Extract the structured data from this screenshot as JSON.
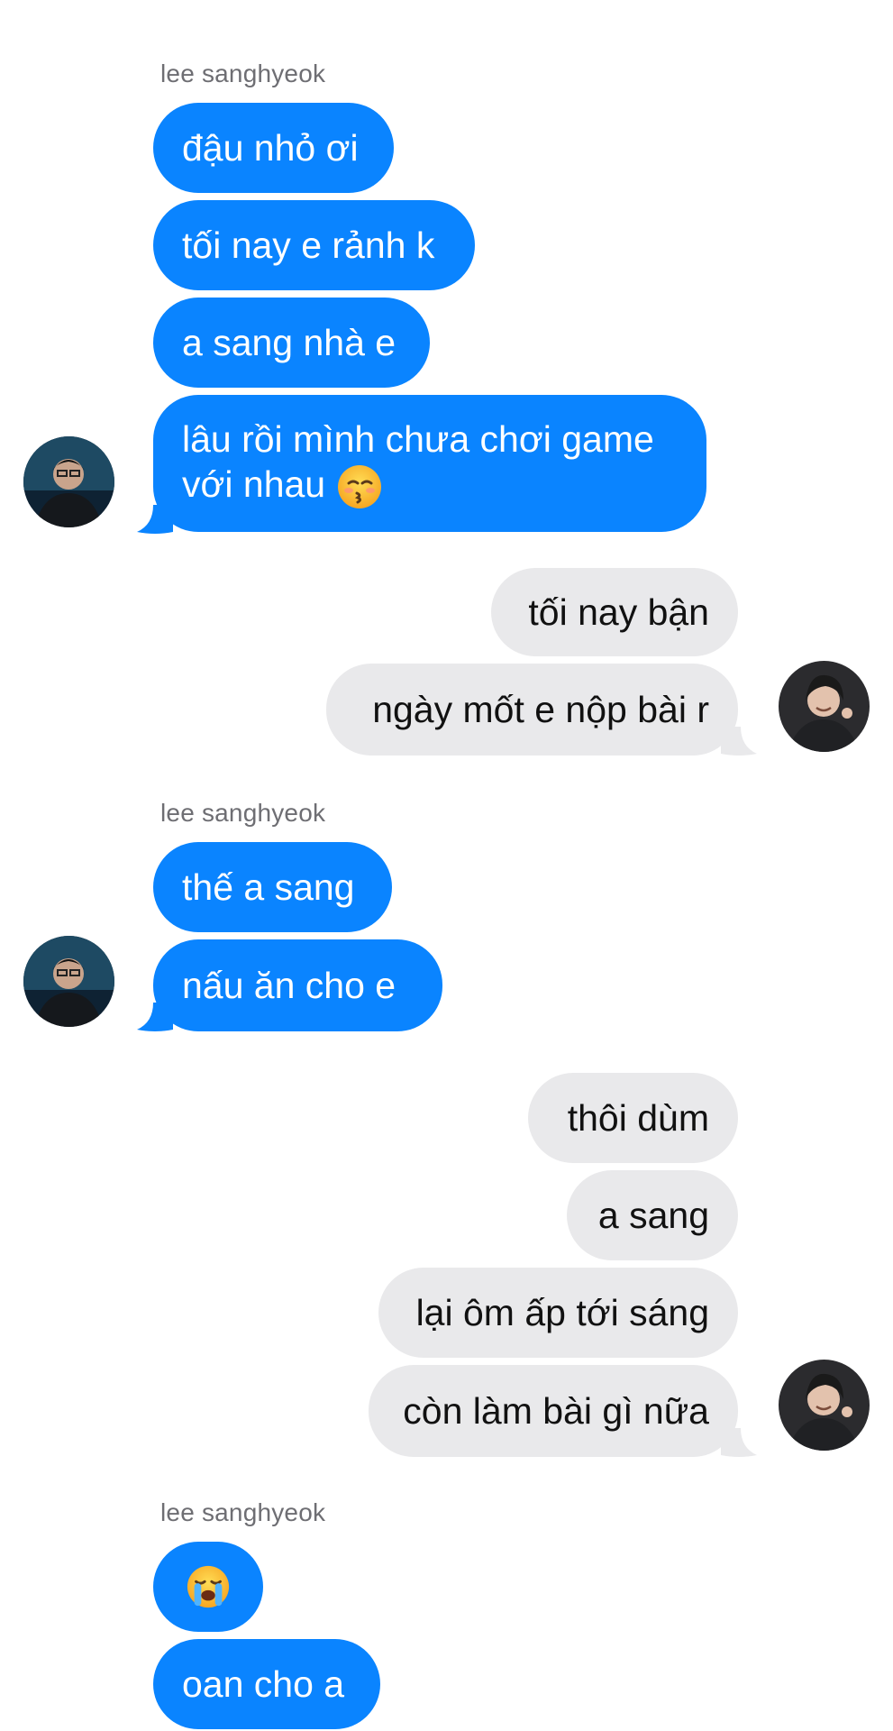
{
  "colors": {
    "incoming": "#0a84ff",
    "outgoing": "#e9e9eb",
    "sender_label": "#6e6e73"
  },
  "groups": [
    {
      "sender": "lee sanghyeok"
    },
    {
      "sender": "lee sanghyeok"
    },
    {
      "sender": "lee sanghyeok"
    }
  ],
  "messages": {
    "m1": "đậu nhỏ ơi",
    "m2": "tối nay e rảnh k",
    "m3": "a sang nhà e",
    "m4": "lâu rồi mình chưa chơi game với nhau",
    "m4_emoji": "kissing-face-icon",
    "m5": "tối nay bận",
    "m6": "ngày mốt e nộp bài r",
    "m7": "thế a sang",
    "m8": "nấu ăn cho e",
    "m9": "thôi dùm",
    "m10": "a sang",
    "m11": "lại ôm ấp tới sáng",
    "m12": "còn làm bài gì nữa",
    "m13_emoji": "loudly-crying-face-icon",
    "m14": "oan cho a"
  }
}
